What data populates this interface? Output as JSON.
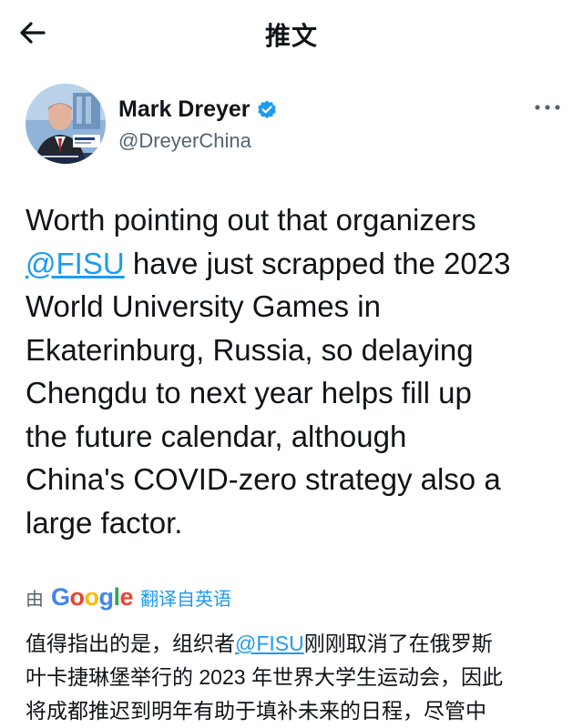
{
  "header": {
    "title": "推文",
    "back_icon": "arrow-left-icon"
  },
  "author": {
    "name": "Mark Dreyer",
    "handle": "@DreyerChina",
    "verified_icon": "verified-badge-icon",
    "more_icon": "more-horizontal-icon",
    "avatar_caption": "Mark Dreyer"
  },
  "tweet": {
    "lines": [
      {
        "text": "Worth pointing out that organizers"
      },
      {
        "mention": "@FISU",
        "text": " have just scrapped the 2023"
      },
      {
        "text": "World University Games in"
      },
      {
        "text": "Ekaterinburg, Russia, so delaying"
      },
      {
        "text": "Chengdu to next year helps fill up"
      },
      {
        "text": "the future calendar, although"
      },
      {
        "text": "China's COVID-zero strategy also a"
      },
      {
        "text": "large factor."
      }
    ]
  },
  "translation": {
    "by_label": "由",
    "google_logo": "Google",
    "label": "翻译自英语",
    "lines": [
      {
        "pre": "值得指出的是，组织者",
        "mention": "@FISU",
        "post": "刚刚取消了在俄罗斯"
      },
      {
        "pre": "叶卡捷琳堡举行的 2023 年世界大学生运动会，因此"
      },
      {
        "pre": "将成都推迟到明年有助于填补未来的日程，尽管中"
      }
    ]
  },
  "colors": {
    "accent": "#1d9bf0",
    "text": "#0f1419",
    "secondary": "#536471"
  }
}
